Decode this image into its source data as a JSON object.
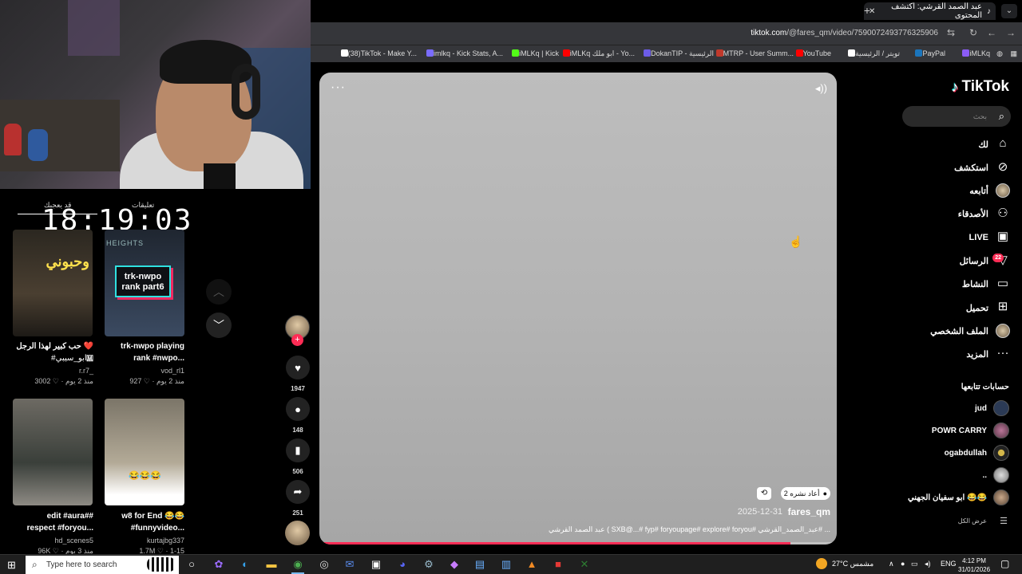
{
  "overlay": {
    "clock": "18:19:03",
    "tab_left": "قد يعجبك",
    "tab_right": "تعليقات"
  },
  "left_videos": [
    {
      "overlay_text": "وحبوني",
      "title_line1": "حب كبير لهذا الرجل ❤️🇲",
      "title_line2": "#ابو_سيبي...",
      "author": "r.r7_",
      "meta": "3002 ♡ · منذ 2 يوم"
    },
    {
      "overlay_top": "HEIGHTS",
      "badge": "trk-nwpo rank part6",
      "title_line1": "trk-nwpo playing",
      "title_line2": "rank #nwpo...",
      "author": "vod_rl1",
      "meta": "927 ♡ · منذ 2 يوم"
    },
    {
      "title_line1": "edit #aura##",
      "title_line2": "respect #foryou...",
      "author": "hd_scenes5",
      "meta": "96K ♡ · منذ 3 يوم"
    },
    {
      "emoji": "😂😂😂",
      "title_line1": "w8 for End 😂😂",
      "title_line2": "#funnyvideo...",
      "author": "kurtajbg337",
      "meta": "1.7M ♡ · 1-15"
    }
  ],
  "browser": {
    "tab_title": "عبد الصمد القرشي: اكتشف المحتوى",
    "url_host": "tiktok.com",
    "url_path": "/@fares_qm/video/7590072493776325906",
    "bookmarks": [
      {
        "label": "iMLKq",
        "color": "#8b5cf6"
      },
      {
        "label": "PayPal",
        "color": "#1b75bc"
      },
      {
        "label": "تويتر / الرئيسية",
        "color": "#ffffff"
      },
      {
        "label": "YouTube",
        "color": "#ff0000"
      },
      {
        "label": "MTRP - User Summ...",
        "color": "#c0392b"
      },
      {
        "label": "DokanTIP - الرئيسية",
        "color": "#6c5ce7"
      },
      {
        "label": "iMLKq ابو ملك - Yo...",
        "color": "#ff0000"
      },
      {
        "label": "iMLKq | Kick",
        "color": "#53fc18"
      },
      {
        "label": "imlkq - Kick Stats, A...",
        "color": "#7a6cff"
      },
      {
        "label": "(38)TikTok - Make Y...",
        "color": "#ffffff"
      }
    ]
  },
  "video": {
    "username": "fares_qm",
    "date": "2025-12-31",
    "description": "عبد الصمد القرشي ( SXB@...# fyp# foryoupage# explore# foryou# عبد_الصمد_القرشي# ...",
    "repost_text": "2 أعاد نشره",
    "progress": 0.91
  },
  "actions": {
    "likes": "1947",
    "comments": "148",
    "saves": "506",
    "shares": "251"
  },
  "sidebar": {
    "logo": "TikTok",
    "search_placeholder": "بحث",
    "nav": [
      {
        "label": "لك",
        "icon": "home-icon"
      },
      {
        "label": "استكشف",
        "icon": "compass-icon"
      },
      {
        "label": "أتابعه",
        "icon": "avatar"
      },
      {
        "label": "الأصدقاء",
        "icon": "friends-icon"
      },
      {
        "label": "LIVE",
        "icon": "live-icon"
      },
      {
        "label": "الرسائل",
        "icon": "inbox-icon"
      },
      {
        "label": "النشاط",
        "icon": "activity-icon"
      },
      {
        "label": "تحميل",
        "icon": "upload-icon"
      },
      {
        "label": "الملف الشخصي",
        "icon": "avatar"
      },
      {
        "label": "المزيد",
        "icon": "more-icon"
      }
    ],
    "messages_badge": "22",
    "following_header": "حسابات تتابعها",
    "following": [
      {
        "name": "jud"
      },
      {
        "name": "POWR CARRY"
      },
      {
        "name": "ogabdullah"
      },
      {
        "name": ".."
      },
      {
        "name": "ابو سفيان الجهني 😂😂"
      }
    ],
    "show_all": "عرض الكل"
  },
  "taskbar": {
    "search_placeholder": "Type here to search",
    "weather": "27°C مشمس",
    "lang": "ENG",
    "time": "4:12 PM",
    "date": "31/01/2026"
  }
}
